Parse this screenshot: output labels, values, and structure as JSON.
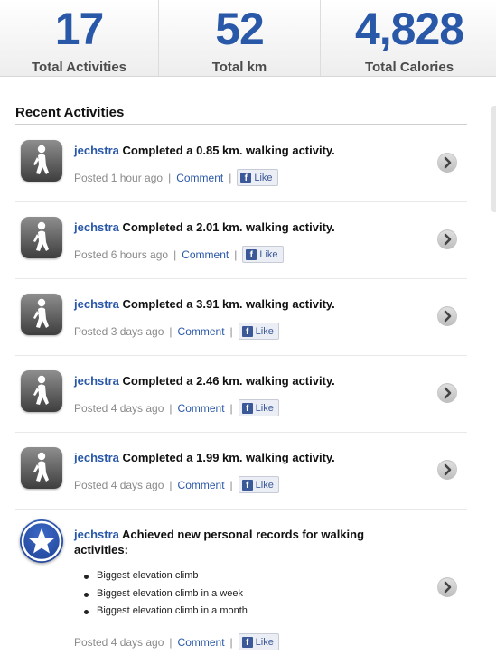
{
  "stats": [
    {
      "value": "17",
      "label": "Total Activities"
    },
    {
      "value": "52",
      "label": "Total km"
    },
    {
      "value": "4,828",
      "label": "Total Calories"
    }
  ],
  "section_title": "Recent Activities",
  "like_label": "Like",
  "comment_label": "Comment",
  "separator": "|",
  "icons": {
    "activity": "walking-figure-icon",
    "record": "star-icon",
    "open": "chevron-right-icon",
    "facebook": "facebook-f-icon"
  },
  "colors": {
    "accent_blue": "#2a58a8",
    "facebook_blue": "#3b5998"
  },
  "activities": [
    {
      "user": "jechstra",
      "text": "Completed a 0.85 km. walking activity.",
      "posted": "Posted 1 hour ago"
    },
    {
      "user": "jechstra",
      "text": "Completed a 2.01 km. walking activity.",
      "posted": "Posted 6 hours ago"
    },
    {
      "user": "jechstra",
      "text": "Completed a 3.91 km. walking activity.",
      "posted": "Posted 3 days ago"
    },
    {
      "user": "jechstra",
      "text": "Completed a 2.46 km. walking activity.",
      "posted": "Posted 4 days ago"
    },
    {
      "user": "jechstra",
      "text": "Completed a 1.99 km. walking activity.",
      "posted": "Posted 4 days ago"
    }
  ],
  "record_activity": {
    "user": "jechstra",
    "text": "Achieved new personal records for walking activities:",
    "records": [
      "Biggest elevation climb",
      "Biggest elevation climb in a week",
      "Biggest elevation climb in a month"
    ],
    "posted": "Posted 4 days ago"
  }
}
